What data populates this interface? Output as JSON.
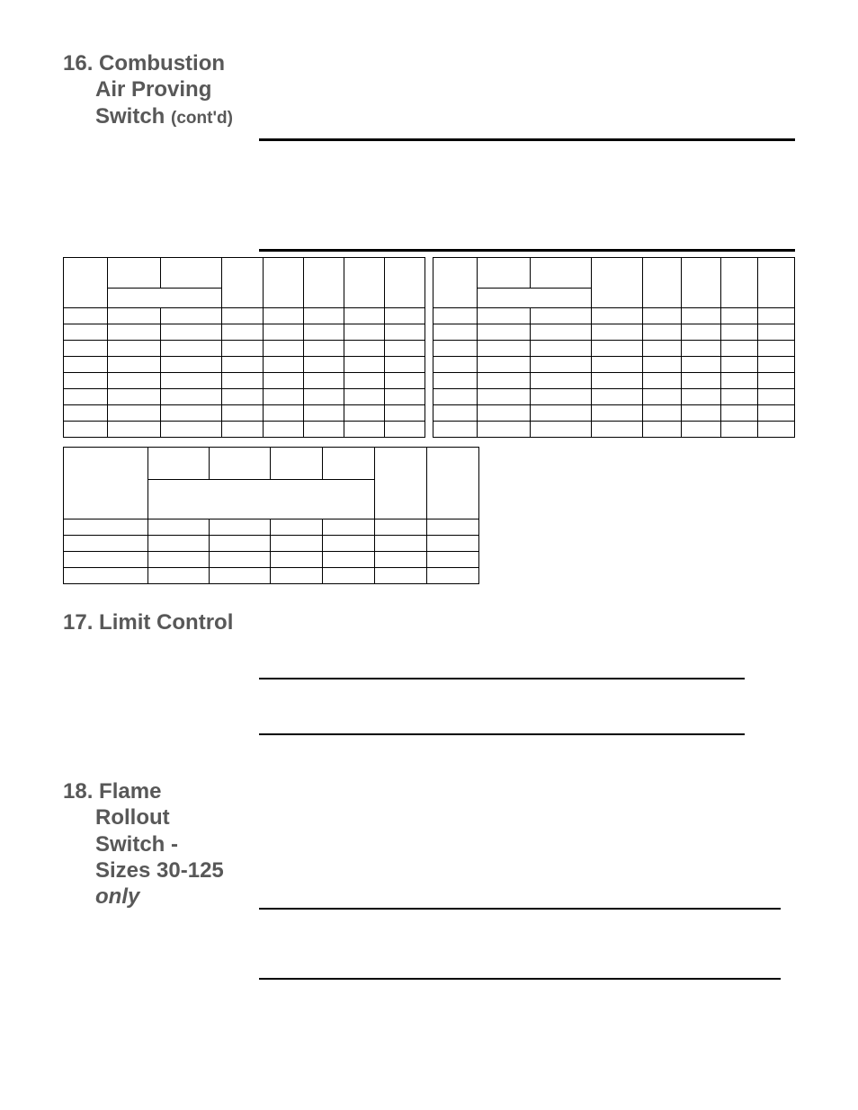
{
  "section16": {
    "number": "16.",
    "title_line1": "Combustion",
    "title_line2": "Air Proving",
    "title_line3_a": "Switch",
    "title_line3_b": "(cont'd)"
  },
  "section17": {
    "number": "17.",
    "title": "Limit Control"
  },
  "section18": {
    "number": "18.",
    "title_line1": "Flame",
    "title_line2": "Rollout",
    "title_line3": "Switch -",
    "title_line4": "Sizes 30-125",
    "title_line5": "only"
  }
}
